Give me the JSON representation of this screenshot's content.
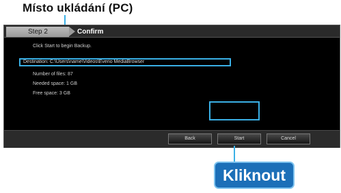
{
  "annotation": {
    "title": "Místo ukládání (PC)",
    "callout": "Kliknout"
  },
  "wizard": {
    "step_label": "Step 2",
    "step_name": "Confirm",
    "lines": [
      "Click Start to begin Backup.",
      "Destination: C:\\Users\\name\\Videos\\Everio MediaBrowser",
      "Number of files: 87",
      "Needed space: 1 GB",
      "Free space: 3 GB"
    ],
    "buttons": {
      "back": "Back",
      "start": "Start",
      "cancel": "Cancel"
    }
  },
  "colors": {
    "highlight": "#3ab0e6",
    "callout_bg": "#1c6fb8"
  }
}
